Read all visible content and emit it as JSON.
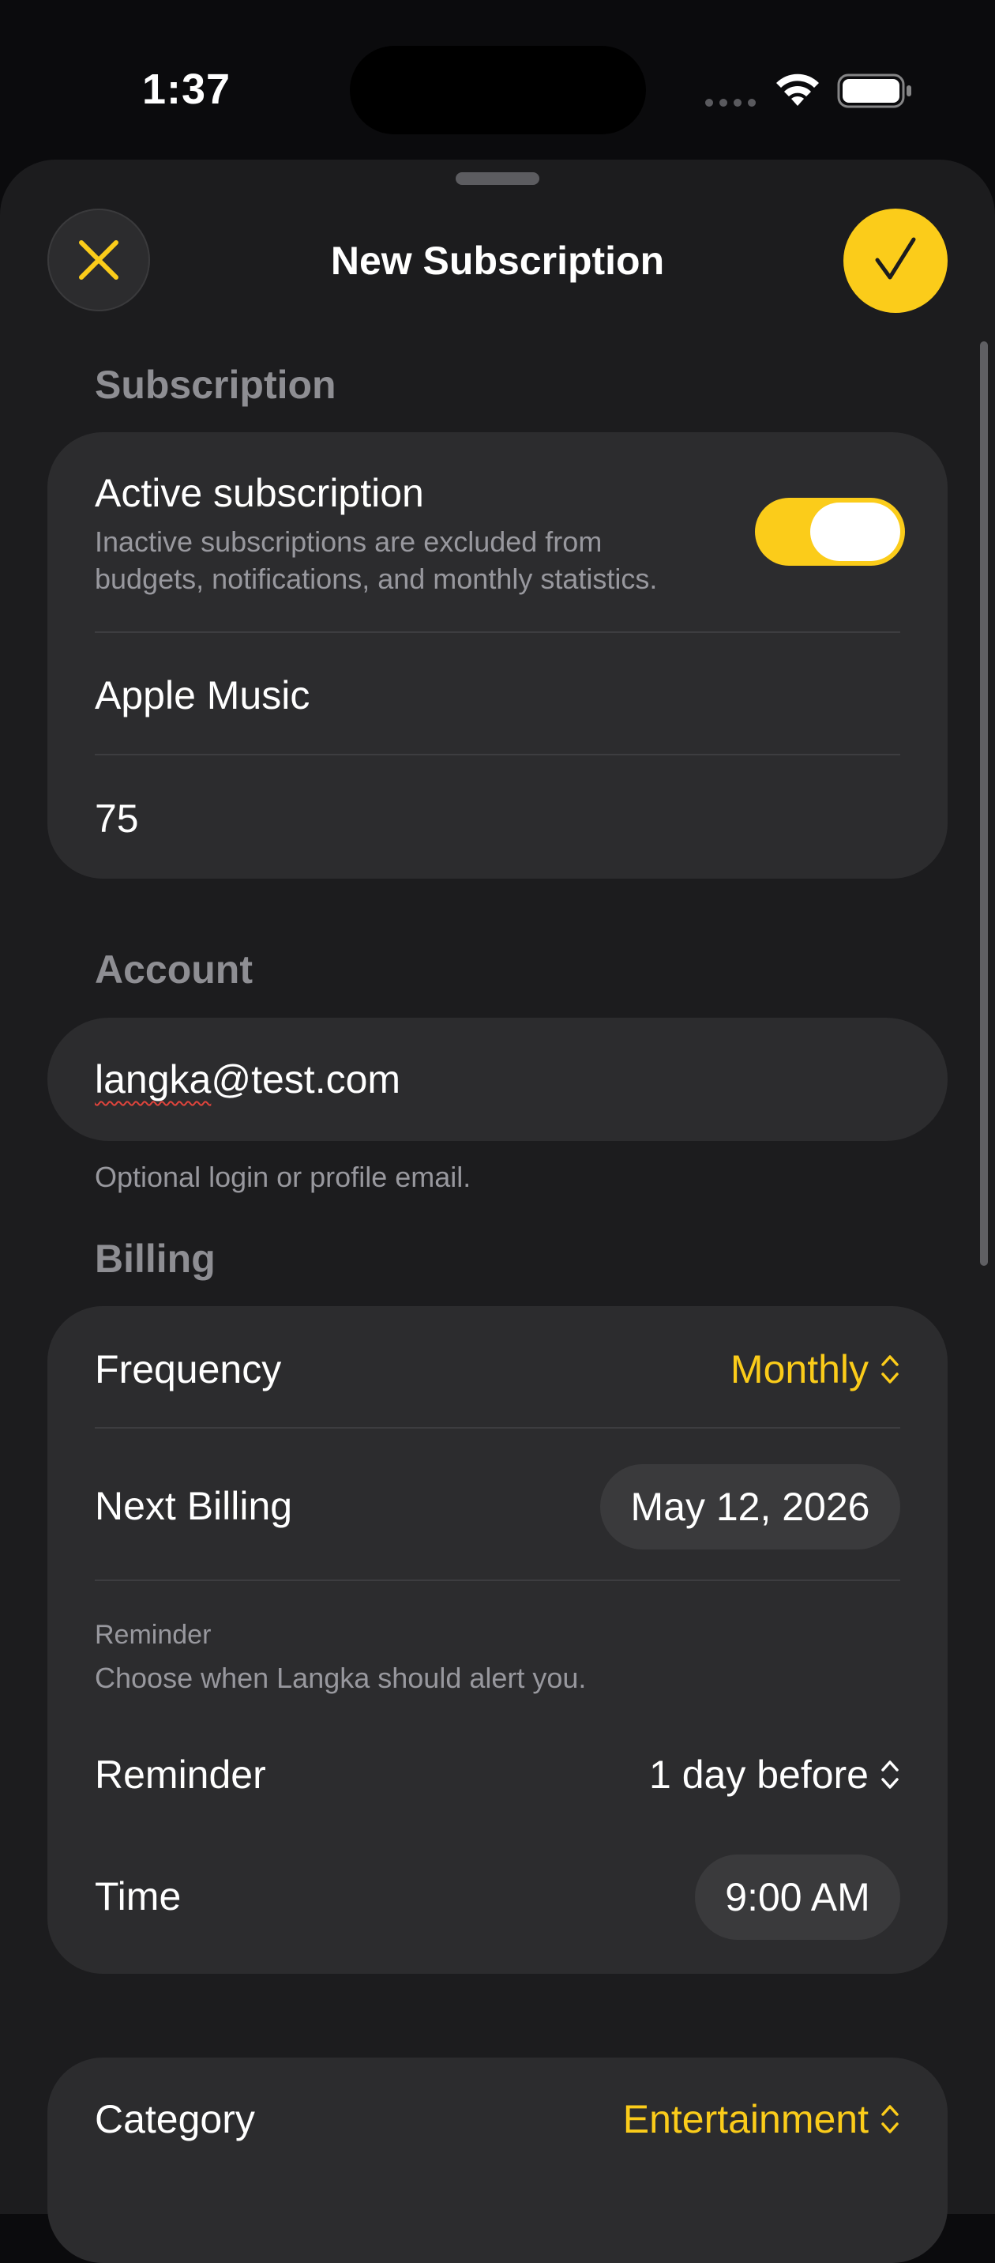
{
  "status_bar": {
    "time": "1:37"
  },
  "header": {
    "title": "New Subscription",
    "close_icon": "xmark-icon",
    "confirm_icon": "checkmark-icon"
  },
  "subscription_section": {
    "label": "Subscription",
    "active": {
      "title": "Active subscription",
      "description_line1": "Inactive subscriptions are excluded from",
      "description_line2": "budgets, notifications, and monthly statistics.",
      "enabled": true
    },
    "name_value": "Apple Music",
    "price_value": "75"
  },
  "account_section": {
    "label": "Account",
    "email_value_part1": "langka",
    "email_value_part2": "@test.com",
    "helper": "Optional login or profile email."
  },
  "billing_section": {
    "label": "Billing",
    "frequency_label": "Frequency",
    "frequency_value": "Monthly",
    "next_billing_label": "Next Billing",
    "next_billing_value": "May 12, 2026",
    "reminder_caption": "Reminder",
    "reminder_helper": "Choose when Langka should alert you.",
    "reminder_label": "Reminder",
    "reminder_value": "1 day before",
    "time_label": "Time",
    "time_value": "9:00 AM"
  },
  "category_section": {
    "category_label": "Category",
    "category_value": "Entertainment"
  },
  "colors": {
    "accent": "#fbcc1a",
    "background": "#0b0b0d",
    "card": "#2c2c2e",
    "secondary_text": "#8e8e93"
  }
}
